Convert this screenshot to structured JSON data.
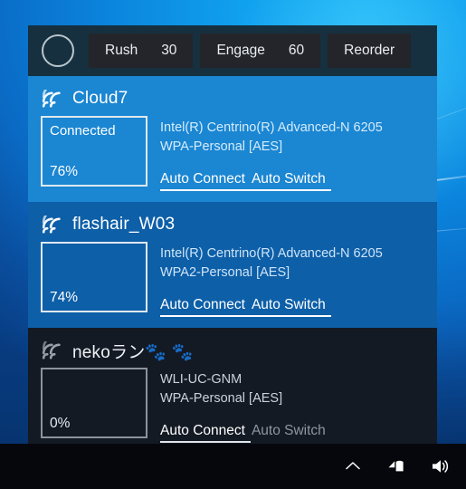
{
  "desktop": {
    "wallpaper_name": "windows-10-hero-wallpaper"
  },
  "flyout": {
    "toolbar": {
      "scan_indicator": "scanning-ring",
      "buttons": [
        {
          "label": "Rush",
          "value": "30",
          "name": "rush-button"
        },
        {
          "label": "Engage",
          "value": "60",
          "name": "engage-button"
        },
        {
          "label": "Reorder",
          "value": "",
          "name": "reorder-button"
        }
      ]
    },
    "networks": [
      {
        "ssid": "Cloud7",
        "status": "Connected",
        "percent": "76%",
        "adapter": "Intel(R) Centrino(R) Advanced-N 6205",
        "security": "WPA-Personal [AES]",
        "auto_connect": "Auto Connect",
        "auto_switch": "Auto Switch",
        "auto_connect_active": true,
        "auto_switch_active": true,
        "signal_bars": 4,
        "state": "selected"
      },
      {
        "ssid": "flashair_W03",
        "status": "",
        "percent": "74%",
        "adapter": "Intel(R) Centrino(R) Advanced-N 6205",
        "security": "WPA2-Personal [AES]",
        "auto_connect": "Auto Connect",
        "auto_switch": "Auto Switch",
        "auto_connect_active": true,
        "auto_switch_active": true,
        "signal_bars": 4,
        "state": "normal"
      },
      {
        "ssid": "nekoラン🐾 🐾",
        "status": "",
        "percent": "0%",
        "adapter": "WLI-UC-GNM",
        "security": "WPA-Personal [AES]",
        "auto_connect": "Auto Connect",
        "auto_switch": "Auto Switch",
        "auto_connect_active": true,
        "auto_switch_active": false,
        "signal_bars": 4,
        "state": "dark"
      }
    ]
  },
  "taskbar": {
    "icons": [
      {
        "name": "show-hidden-icons-chevron",
        "glyph": "chevron-up"
      },
      {
        "name": "network-icon",
        "glyph": "network"
      },
      {
        "name": "volume-icon",
        "glyph": "speaker"
      }
    ]
  },
  "colors": {
    "panel_header": "#16303f",
    "row_selected": "#1b86d2",
    "row_normal": "#0d5fa8",
    "row_dark": "#141a24",
    "taskbar": "#05070d",
    "accent_text": "#ffffff"
  }
}
